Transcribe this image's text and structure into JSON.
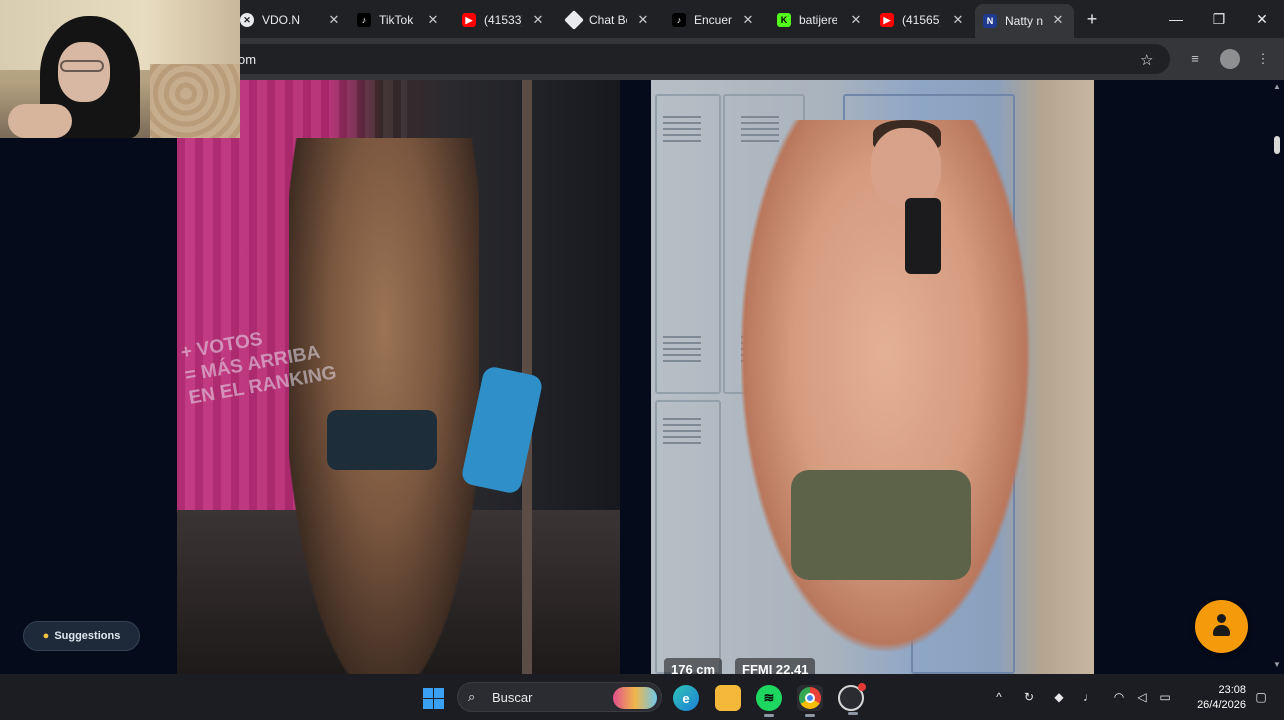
{
  "browser": {
    "tabs": [
      {
        "title": "",
        "favicon": "",
        "color": "#202124"
      },
      {
        "title": "VDO.N",
        "favicon": "vdo-ninja-icon",
        "color": "#e8eaed"
      },
      {
        "title": "TikTok",
        "favicon": "tiktok-icon",
        "color": "#000000"
      },
      {
        "title": "(41533)",
        "favicon": "youtube-icon",
        "color": "#ff0000"
      },
      {
        "title": "Chat Bo",
        "favicon": "diamond-icon",
        "color": "#e8eaed"
      },
      {
        "title": "Encuen",
        "favicon": "tiktok-icon",
        "color": "#000000"
      },
      {
        "title": "batijere",
        "favicon": "kick-icon",
        "color": "#53fc18"
      },
      {
        "title": "(41565)",
        "favicon": "youtube-icon",
        "color": "#ff0000"
      },
      {
        "title": "Natty n",
        "favicon": "n-icon",
        "color": "#1f3b8f"
      }
    ],
    "new_tab_label": "+",
    "url": "om",
    "controls": {
      "minimize": "—",
      "maximize": "❐",
      "close": "✕"
    }
  },
  "page": {
    "overlay_text_line1": "+ VOTOS",
    "overlay_text_line2": "= MÁS ARRIBA",
    "overlay_text_line3": "EN EL RANKING",
    "height_label": "176 cm",
    "ffmi_label": "FFMI 22.41",
    "suggestions_label": "Suggestions",
    "fab_icon": "person-icon",
    "accent_color": "#f59a0b"
  },
  "taskbar": {
    "search_placeholder": "Buscar",
    "apps": [
      "edge-icon",
      "file-explorer-icon",
      "spotify-icon",
      "chrome-icon",
      "obs-icon"
    ],
    "time": "23:08",
    "date": "26/4/2026"
  }
}
